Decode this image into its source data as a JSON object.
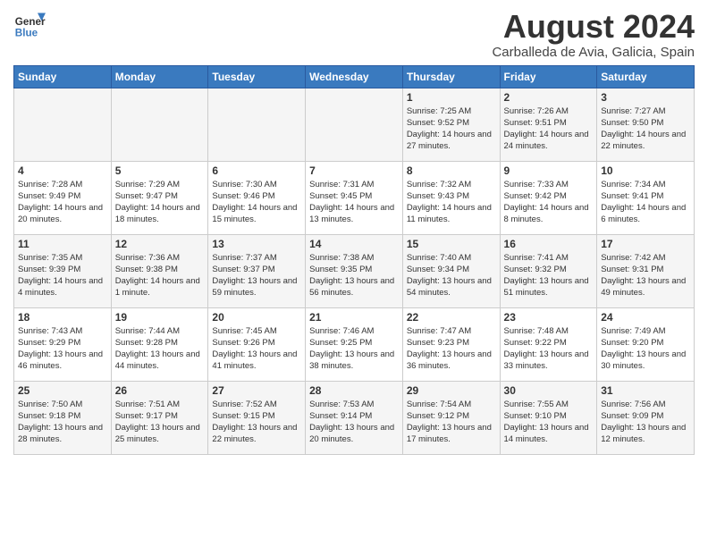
{
  "header": {
    "logo_line1": "General",
    "logo_line2": "Blue",
    "month": "August 2024",
    "location": "Carballeda de Avia, Galicia, Spain"
  },
  "columns": [
    "Sunday",
    "Monday",
    "Tuesday",
    "Wednesday",
    "Thursday",
    "Friday",
    "Saturday"
  ],
  "weeks": [
    [
      {
        "day": "",
        "info": ""
      },
      {
        "day": "",
        "info": ""
      },
      {
        "day": "",
        "info": ""
      },
      {
        "day": "",
        "info": ""
      },
      {
        "day": "1",
        "info": "Sunrise: 7:25 AM\nSunset: 9:52 PM\nDaylight: 14 hours and 27 minutes."
      },
      {
        "day": "2",
        "info": "Sunrise: 7:26 AM\nSunset: 9:51 PM\nDaylight: 14 hours and 24 minutes."
      },
      {
        "day": "3",
        "info": "Sunrise: 7:27 AM\nSunset: 9:50 PM\nDaylight: 14 hours and 22 minutes."
      }
    ],
    [
      {
        "day": "4",
        "info": "Sunrise: 7:28 AM\nSunset: 9:49 PM\nDaylight: 14 hours and 20 minutes."
      },
      {
        "day": "5",
        "info": "Sunrise: 7:29 AM\nSunset: 9:47 PM\nDaylight: 14 hours and 18 minutes."
      },
      {
        "day": "6",
        "info": "Sunrise: 7:30 AM\nSunset: 9:46 PM\nDaylight: 14 hours and 15 minutes."
      },
      {
        "day": "7",
        "info": "Sunrise: 7:31 AM\nSunset: 9:45 PM\nDaylight: 14 hours and 13 minutes."
      },
      {
        "day": "8",
        "info": "Sunrise: 7:32 AM\nSunset: 9:43 PM\nDaylight: 14 hours and 11 minutes."
      },
      {
        "day": "9",
        "info": "Sunrise: 7:33 AM\nSunset: 9:42 PM\nDaylight: 14 hours and 8 minutes."
      },
      {
        "day": "10",
        "info": "Sunrise: 7:34 AM\nSunset: 9:41 PM\nDaylight: 14 hours and 6 minutes."
      }
    ],
    [
      {
        "day": "11",
        "info": "Sunrise: 7:35 AM\nSunset: 9:39 PM\nDaylight: 14 hours and 4 minutes."
      },
      {
        "day": "12",
        "info": "Sunrise: 7:36 AM\nSunset: 9:38 PM\nDaylight: 14 hours and 1 minute."
      },
      {
        "day": "13",
        "info": "Sunrise: 7:37 AM\nSunset: 9:37 PM\nDaylight: 13 hours and 59 minutes."
      },
      {
        "day": "14",
        "info": "Sunrise: 7:38 AM\nSunset: 9:35 PM\nDaylight: 13 hours and 56 minutes."
      },
      {
        "day": "15",
        "info": "Sunrise: 7:40 AM\nSunset: 9:34 PM\nDaylight: 13 hours and 54 minutes."
      },
      {
        "day": "16",
        "info": "Sunrise: 7:41 AM\nSunset: 9:32 PM\nDaylight: 13 hours and 51 minutes."
      },
      {
        "day": "17",
        "info": "Sunrise: 7:42 AM\nSunset: 9:31 PM\nDaylight: 13 hours and 49 minutes."
      }
    ],
    [
      {
        "day": "18",
        "info": "Sunrise: 7:43 AM\nSunset: 9:29 PM\nDaylight: 13 hours and 46 minutes."
      },
      {
        "day": "19",
        "info": "Sunrise: 7:44 AM\nSunset: 9:28 PM\nDaylight: 13 hours and 44 minutes."
      },
      {
        "day": "20",
        "info": "Sunrise: 7:45 AM\nSunset: 9:26 PM\nDaylight: 13 hours and 41 minutes."
      },
      {
        "day": "21",
        "info": "Sunrise: 7:46 AM\nSunset: 9:25 PM\nDaylight: 13 hours and 38 minutes."
      },
      {
        "day": "22",
        "info": "Sunrise: 7:47 AM\nSunset: 9:23 PM\nDaylight: 13 hours and 36 minutes."
      },
      {
        "day": "23",
        "info": "Sunrise: 7:48 AM\nSunset: 9:22 PM\nDaylight: 13 hours and 33 minutes."
      },
      {
        "day": "24",
        "info": "Sunrise: 7:49 AM\nSunset: 9:20 PM\nDaylight: 13 hours and 30 minutes."
      }
    ],
    [
      {
        "day": "25",
        "info": "Sunrise: 7:50 AM\nSunset: 9:18 PM\nDaylight: 13 hours and 28 minutes."
      },
      {
        "day": "26",
        "info": "Sunrise: 7:51 AM\nSunset: 9:17 PM\nDaylight: 13 hours and 25 minutes."
      },
      {
        "day": "27",
        "info": "Sunrise: 7:52 AM\nSunset: 9:15 PM\nDaylight: 13 hours and 22 minutes."
      },
      {
        "day": "28",
        "info": "Sunrise: 7:53 AM\nSunset: 9:14 PM\nDaylight: 13 hours and 20 minutes."
      },
      {
        "day": "29",
        "info": "Sunrise: 7:54 AM\nSunset: 9:12 PM\nDaylight: 13 hours and 17 minutes."
      },
      {
        "day": "30",
        "info": "Sunrise: 7:55 AM\nSunset: 9:10 PM\nDaylight: 13 hours and 14 minutes."
      },
      {
        "day": "31",
        "info": "Sunrise: 7:56 AM\nSunset: 9:09 PM\nDaylight: 13 hours and 12 minutes."
      }
    ]
  ]
}
